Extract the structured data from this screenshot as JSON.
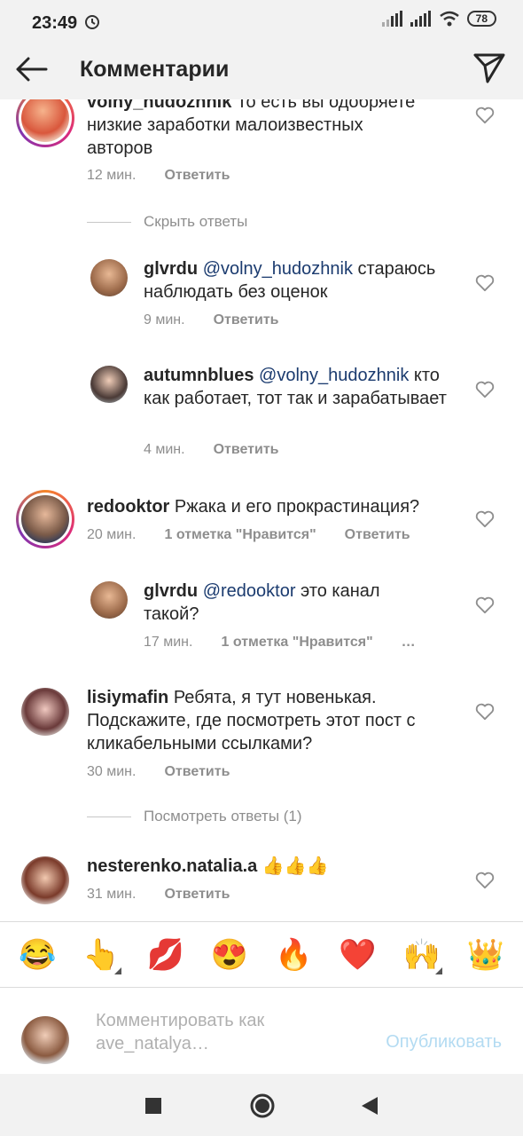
{
  "status_bar": {
    "time": "23:49",
    "battery": "78"
  },
  "header": {
    "title": "Комментарии"
  },
  "comments": [
    {
      "username": "volny_hudozhnik",
      "text": "То есть вы одобряете низкие заработки малоизвестных авторов",
      "time": "12 мин.",
      "reply": "Ответить",
      "toggle": "Скрыть ответы",
      "replies": [
        {
          "username": "glvrdu",
          "mention": "@volny_hudozhnik",
          "text": "стараюсь наблюдать без оценок",
          "time": "9 мин.",
          "reply": "Ответить"
        },
        {
          "username": "autumnblues",
          "mention": "@volny_hudozhnik",
          "text": "кто как работает, тот так и зарабатывает",
          "time": "4 мин.",
          "reply": "Ответить"
        }
      ]
    },
    {
      "username": "redooktor",
      "text": "Ржака и его прокрастинация?",
      "time": "20 мин.",
      "likes": "1 отметка \"Нравится\"",
      "reply": "Ответить",
      "replies": [
        {
          "username": "glvrdu",
          "mention": "@redooktor",
          "text": "это канал такой?",
          "time": "17 мин.",
          "likes": "1 отметка \"Нравится\"",
          "more": "…"
        }
      ]
    },
    {
      "username": "lisiymafin",
      "text": "Ребята, я тут новенькая. Подскажите, где посмотреть этот пост с кликабельными ссылками?",
      "time": "30 мин.",
      "reply": "Ответить",
      "toggle": "Посмотреть ответы (1)"
    },
    {
      "username": "nesterenko.natalia.a",
      "text": "👍👍👍",
      "time": "31 мин.",
      "reply": "Ответить"
    }
  ],
  "emoji_bar": [
    "😂",
    "👆",
    "💋",
    "😍",
    "🔥",
    "❤️",
    "🙌",
    "👑"
  ],
  "input": {
    "placeholder": "Комментировать как ave_natalya…",
    "publish": "Опубликовать"
  },
  "colors": {
    "mention": "#1b3b6f",
    "publish_disabled": "#b3dbf2",
    "meta": "#8e8e8e"
  }
}
